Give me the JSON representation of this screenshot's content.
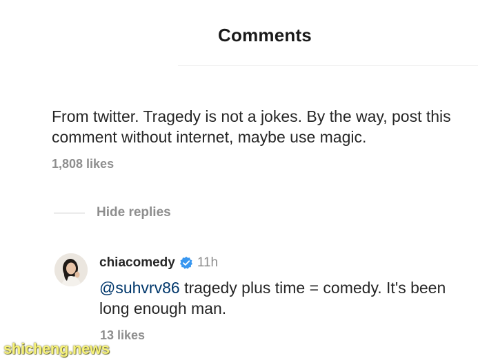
{
  "header": {
    "title": "Comments"
  },
  "comment": {
    "text": "From twitter. Tragedy is not a jokes. By the way, post this comment without internet, maybe use magic.",
    "likes": "1,808 likes",
    "hide_replies_label": "Hide replies"
  },
  "reply": {
    "username": "chiacomedy",
    "verified_icon": "verified-badge-icon",
    "time": "11h",
    "mention": "@suhvrv86",
    "text": " tragedy plus time = comedy. It's been long enough man.",
    "likes": "13 likes"
  },
  "watermark": {
    "text": "shicheng.news"
  },
  "colors": {
    "text": "#262626",
    "secondary": "#8e8e8e",
    "mention": "#00376b",
    "verified": "#3897f0"
  }
}
